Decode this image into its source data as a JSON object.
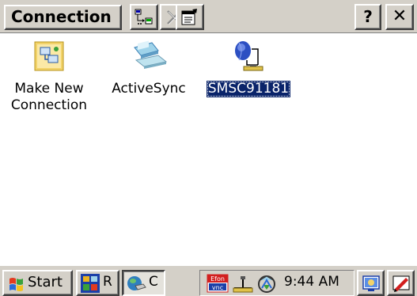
{
  "window": {
    "menu_title": "Connection",
    "help_label": "?",
    "close_label": "✕"
  },
  "toolbar": {
    "buttons": [
      {
        "icon": "connect-icon"
      },
      {
        "icon": "delete-icon"
      },
      {
        "icon": "properties-icon"
      }
    ]
  },
  "items": [
    {
      "label_line1": "Make New",
      "label_line2": "Connection",
      "icon": "make-new-connection-icon",
      "selected": false
    },
    {
      "label_line1": "ActiveSync",
      "label_line2": "",
      "icon": "activesync-icon",
      "selected": false
    },
    {
      "label_line1": "SMSC91181",
      "label_line2": "",
      "icon": "network-adapter-icon",
      "selected": true
    }
  ],
  "taskbar": {
    "start_label": "Start",
    "tasks": [
      {
        "label": "R",
        "icon": "remote-display-icon"
      },
      {
        "label": "C",
        "icon": "connections-icon"
      }
    ],
    "tray": {
      "vnc_label": "Efon\nvnc",
      "time": "9:44 AM"
    }
  },
  "colors": {
    "chrome": "#d4d0c8",
    "selection": "#0a246a",
    "background": "#ffffff"
  }
}
